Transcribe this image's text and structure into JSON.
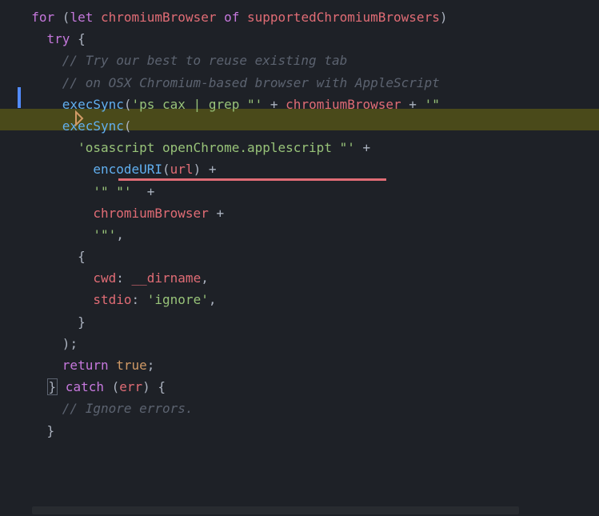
{
  "code": {
    "line1": {
      "kw_for": "for",
      "paren_open": " (",
      "kw_let": "let",
      "var1": " chromiumBrowser",
      "kw_of": " of",
      "var2": " supportedChromiumBrowsers",
      "paren_close": ")"
    },
    "line2": {
      "kw_try": "try",
      "brace": " {"
    },
    "line3": {
      "comment": "// Try our best to reuse existing tab"
    },
    "line4": {
      "comment": "// on OSX Chromium-based browser with AppleScript"
    },
    "line5": {
      "fn": "execSync",
      "paren": "(",
      "str1": "'ps cax | grep \"'",
      "op1": " + ",
      "var1": "chromiumBrowser",
      "op2": " + ",
      "str2": "'\""
    },
    "line6": {
      "fn": "execSync",
      "paren": "("
    },
    "line7": {
      "str": "'osascript openChrome.applescript \"'",
      "op": " +"
    },
    "line8": {
      "fn": "encodeURI",
      "paren_open": "(",
      "var": "url",
      "paren_close": ")",
      "op": " +"
    },
    "line9": {
      "str": "'\" \"'",
      "op": "  +"
    },
    "line10": {
      "var": "chromiumBrowser",
      "op": " +"
    },
    "line11": {
      "str": "'\"'",
      "comma": ","
    },
    "line12": {
      "brace": "{"
    },
    "line13": {
      "prop": "cwd",
      "colon": ": ",
      "var": "__dirname",
      "comma": ","
    },
    "line14": {
      "prop": "stdio",
      "colon": ": ",
      "str": "'ignore'",
      "comma": ","
    },
    "line15": {
      "brace": "}"
    },
    "line16": {
      "paren": ")",
      "semi": ";"
    },
    "line17": {
      "kw": "return",
      "val": " true",
      "semi": ";"
    },
    "line18": {
      "brace_close": "}",
      "kw_catch": " catch",
      "paren_open": " (",
      "var": "err",
      "paren_close": ")",
      "brace_open": " {"
    },
    "line19": {
      "comment": "// Ignore errors."
    },
    "line20": {
      "brace": "}"
    }
  }
}
